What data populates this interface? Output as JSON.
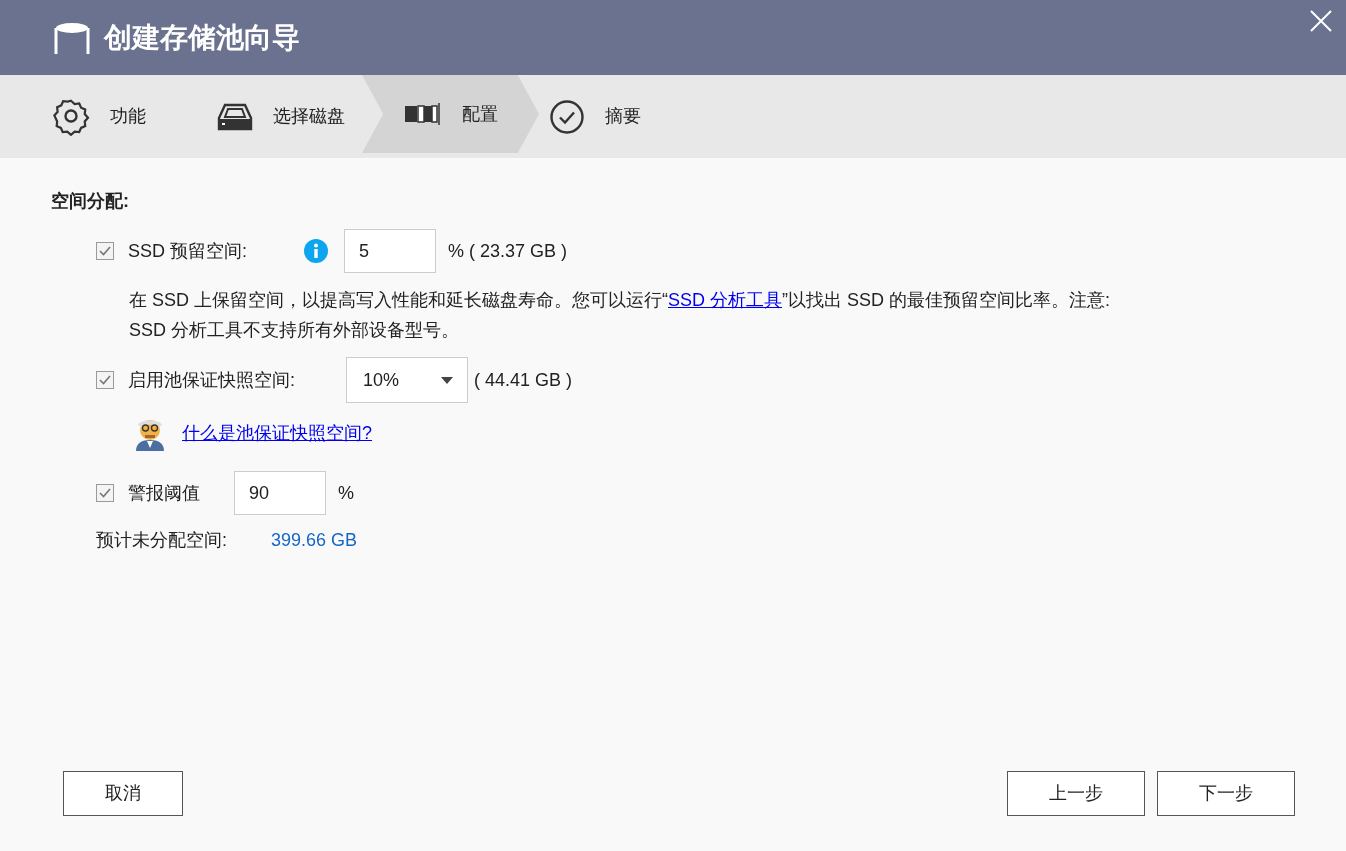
{
  "window": {
    "title": "创建存储池向导"
  },
  "steps": [
    {
      "label": "功能",
      "selected": false
    },
    {
      "label": "选择磁盘",
      "selected": false
    },
    {
      "label": "配置",
      "selected": true
    },
    {
      "label": "摘要",
      "selected": false
    }
  ],
  "section_title": "空间分配:",
  "ssd_reserve": {
    "checked": true,
    "label": "SSD 预留空间:",
    "value": "5",
    "unit": "% ( 23.37 GB )",
    "description": {
      "before": "在 SSD 上保留空间，以提高写入性能和延长磁盘寿命。您可以运行“",
      "link": "SSD 分析工具",
      "after": "”以找出 SSD 的最佳预留空间比率。注意:",
      "continuation": "SSD 分析工具不支持所有外部设备型号。"
    }
  },
  "snapshot_space": {
    "checked": true,
    "label": "启用池保证快照空间:",
    "value": "10%",
    "size": "( 44.41 GB )",
    "help_link": "什么是池保证快照空间?"
  },
  "alert_threshold": {
    "checked": true,
    "label": "警报阈值",
    "value": "90",
    "unit": "%"
  },
  "estimate": {
    "label": "预计未分配空间:",
    "value": "399.66 GB"
  },
  "buttons": {
    "cancel": "取消",
    "back": "上一步",
    "next": "下一步"
  }
}
